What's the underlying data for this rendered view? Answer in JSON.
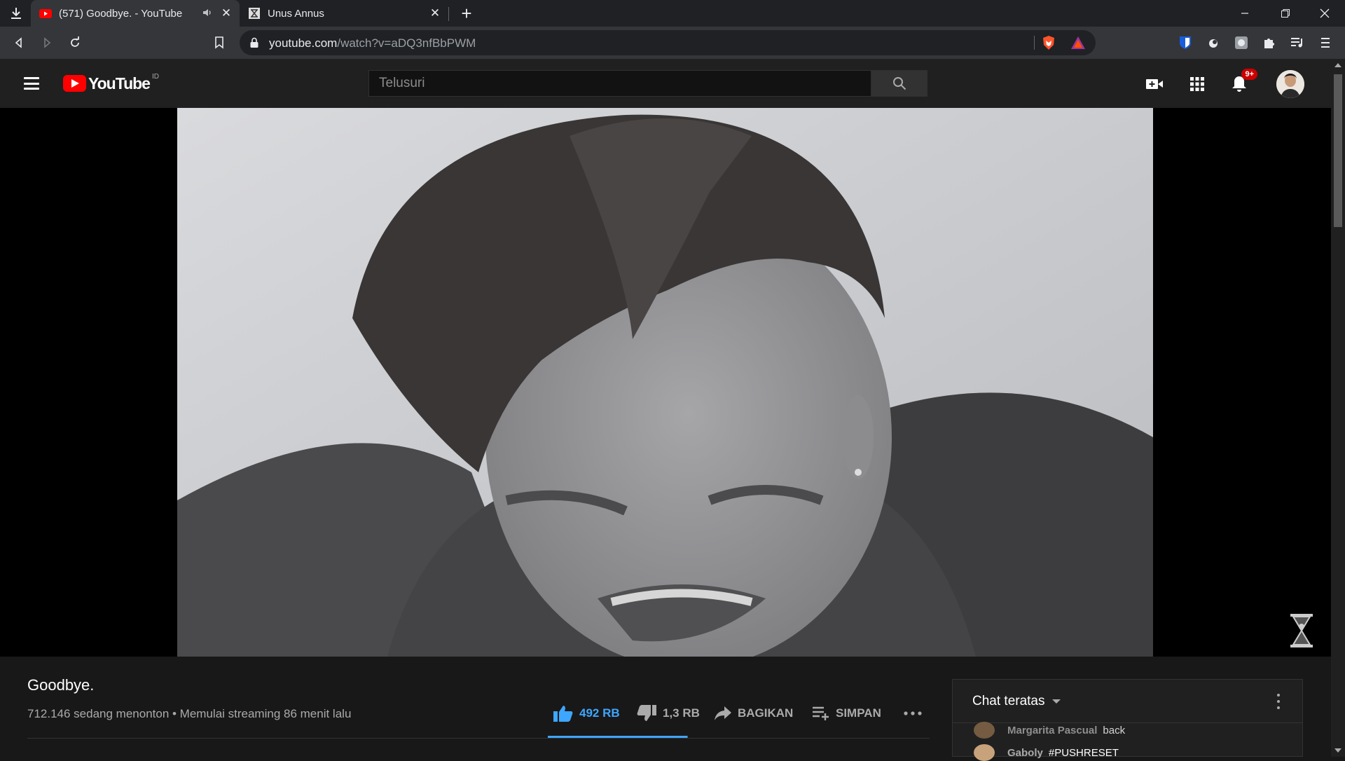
{
  "browser": {
    "tabs": [
      {
        "title": "(571) Goodbye. - YouTube",
        "active": true,
        "audio": true
      },
      {
        "title": "Unus Annus",
        "active": false,
        "audio": false
      }
    ],
    "new_tab_label": "+",
    "url_host": "youtube.com",
    "url_path": "/watch?v=aDQ3nfBbPWM",
    "icons": [
      "download-icon",
      "back-icon",
      "forward-icon",
      "reload-icon",
      "bookmark-icon",
      "lock-icon",
      "brave-shield-icon",
      "brave-rewards-icon",
      "extension-icons",
      "puzzle-icon",
      "media-icon",
      "menu-icon"
    ]
  },
  "youtube": {
    "country_code": "ID",
    "search_placeholder": "Telusuri",
    "notification_count": "9+"
  },
  "video": {
    "title": "Goodbye.",
    "meta": "712.146 sedang menonton • Memulai streaming 86 menit lalu",
    "likes": "492 RB",
    "dislikes": "1,3 RB",
    "share_label": "BAGIKAN",
    "save_label": "SIMPAN",
    "like_ratio": 0.997
  },
  "chat": {
    "mode_label": "Chat teratas",
    "messages": [
      {
        "author": "Margarita Pascual",
        "text": "back"
      },
      {
        "author": "Gaboly",
        "text": "#PUSHRESET"
      }
    ]
  },
  "colors": {
    "accent_blue": "#3ea6ff",
    "youtube_red": "#ff0000",
    "badge_red": "#cc0000"
  }
}
